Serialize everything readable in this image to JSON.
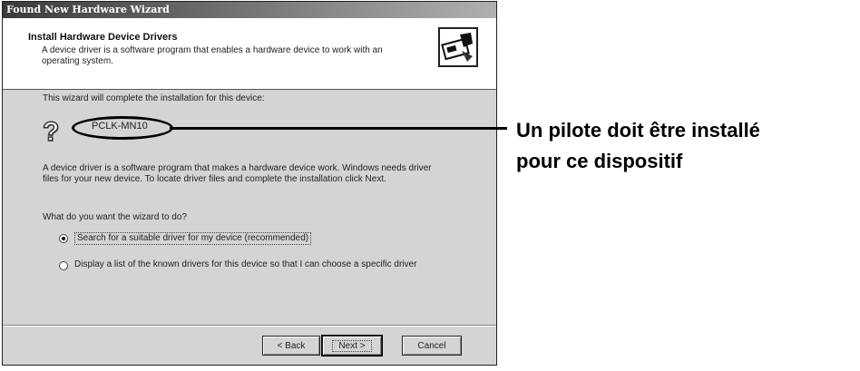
{
  "window": {
    "title": "Found New Hardware Wizard"
  },
  "header": {
    "title": "Install Hardware Device Drivers",
    "description": "A device driver is a software program that enables a hardware device to work with an operating system.",
    "icon": "hardware-install-icon"
  },
  "content": {
    "intro": "This wizard will complete the installation for this device:",
    "device_icon": "question-mark-icon",
    "device_name": "PCLK-MN10",
    "paragraph": "A device driver is a software program that makes a hardware device work. Windows needs driver files for your new device. To locate driver files and complete the installation click Next.",
    "question": "What do you want the wizard to do?",
    "options": [
      {
        "label": "Search for a suitable driver for my device (recommended)",
        "selected": true
      },
      {
        "label": "Display a list of the known drivers for this device so that I can choose a specific driver",
        "selected": false
      }
    ]
  },
  "buttons": {
    "back": "< Back",
    "next": "Next >",
    "cancel": "Cancel"
  },
  "annotation": {
    "line1": "Un pilote doit être installé",
    "line2": "pour ce dispositif"
  }
}
